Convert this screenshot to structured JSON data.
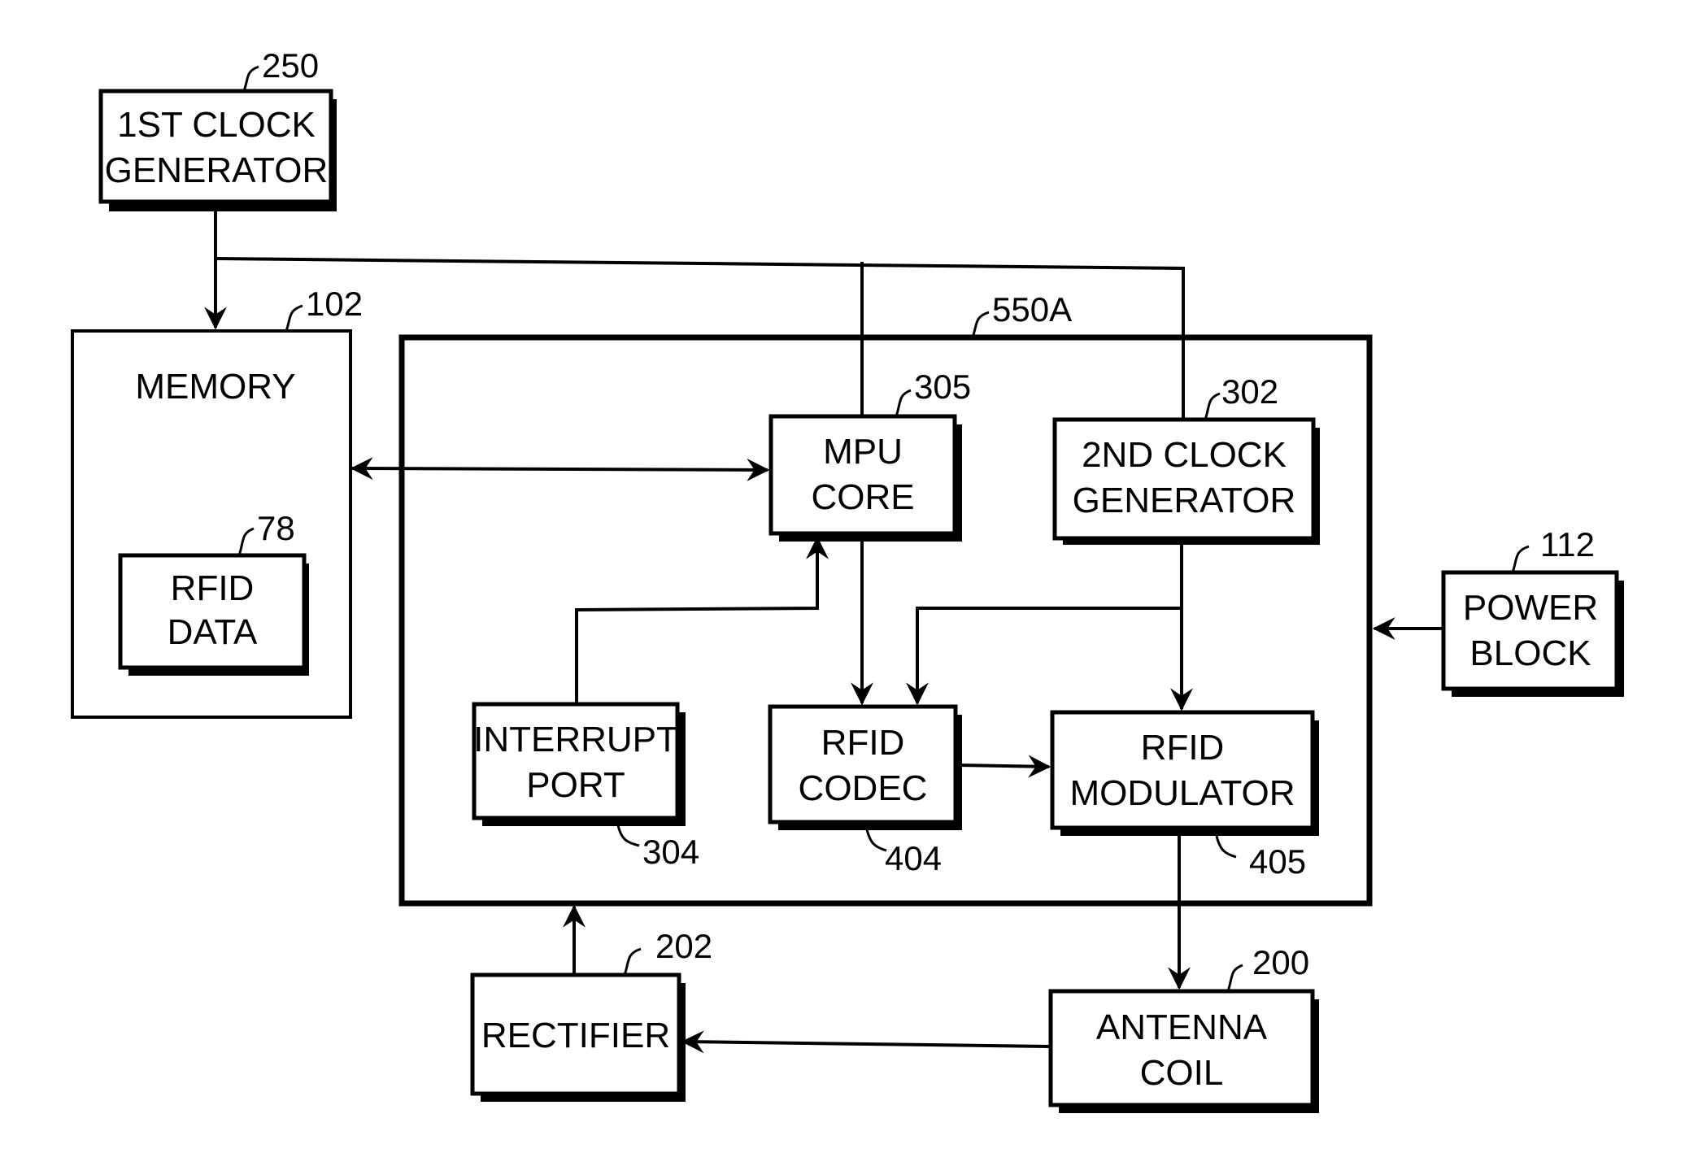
{
  "diagram": {
    "type": "block-diagram",
    "blocks": {
      "clock1": {
        "label_lines": [
          "1ST CLOCK",
          "GENERATOR"
        ],
        "ref": "250"
      },
      "memory": {
        "label_lines": [
          "MEMORY"
        ],
        "ref": "102"
      },
      "rfid_data": {
        "label_lines": [
          "RFID",
          "DATA"
        ],
        "ref": "78"
      },
      "chip": {
        "label_lines": [],
        "ref": "550A"
      },
      "mpu": {
        "label_lines": [
          "MPU",
          "CORE"
        ],
        "ref": "305"
      },
      "clock2": {
        "label_lines": [
          "2ND CLOCK",
          "GENERATOR"
        ],
        "ref": "302"
      },
      "interrupt": {
        "label_lines": [
          "INTERRUPT",
          "PORT"
        ],
        "ref": "304"
      },
      "codec": {
        "label_lines": [
          "RFID",
          "CODEC"
        ],
        "ref": "404"
      },
      "modulator": {
        "label_lines": [
          "RFID",
          "MODULATOR"
        ],
        "ref": "405"
      },
      "power": {
        "label_lines": [
          "POWER",
          "BLOCK"
        ],
        "ref": "112"
      },
      "rectifier": {
        "label_lines": [
          "RECTIFIER"
        ],
        "ref": "202"
      },
      "antenna": {
        "label_lines": [
          "ANTENNA",
          "COIL"
        ],
        "ref": "200"
      }
    },
    "connections": [
      {
        "from": "1ST CLOCK GENERATOR",
        "to": "MEMORY",
        "kind": "arrow"
      },
      {
        "from": "1ST CLOCK GENERATOR",
        "to": "MPU CORE",
        "kind": "line"
      },
      {
        "from": "1ST CLOCK GENERATOR",
        "to": "2ND CLOCK GENERATOR",
        "kind": "line"
      },
      {
        "from": "MEMORY",
        "to": "MPU CORE",
        "kind": "bidirectional"
      },
      {
        "from": "INTERRUPT PORT",
        "to": "MPU CORE",
        "kind": "arrow"
      },
      {
        "from": "MPU CORE",
        "to": "RFID CODEC",
        "kind": "arrow"
      },
      {
        "from": "2ND CLOCK GENERATOR",
        "to": "RFID CODEC",
        "kind": "arrow"
      },
      {
        "from": "2ND CLOCK GENERATOR",
        "to": "RFID MODULATOR",
        "kind": "arrow"
      },
      {
        "from": "RFID CODEC",
        "to": "RFID MODULATOR",
        "kind": "arrow"
      },
      {
        "from": "POWER BLOCK",
        "to": "550A",
        "kind": "arrow"
      },
      {
        "from": "RFID MODULATOR",
        "to": "ANTENNA COIL",
        "kind": "arrow"
      },
      {
        "from": "ANTENNA COIL",
        "to": "RECTIFIER",
        "kind": "arrow"
      },
      {
        "from": "RECTIFIER",
        "to": "550A",
        "kind": "arrow"
      }
    ]
  }
}
